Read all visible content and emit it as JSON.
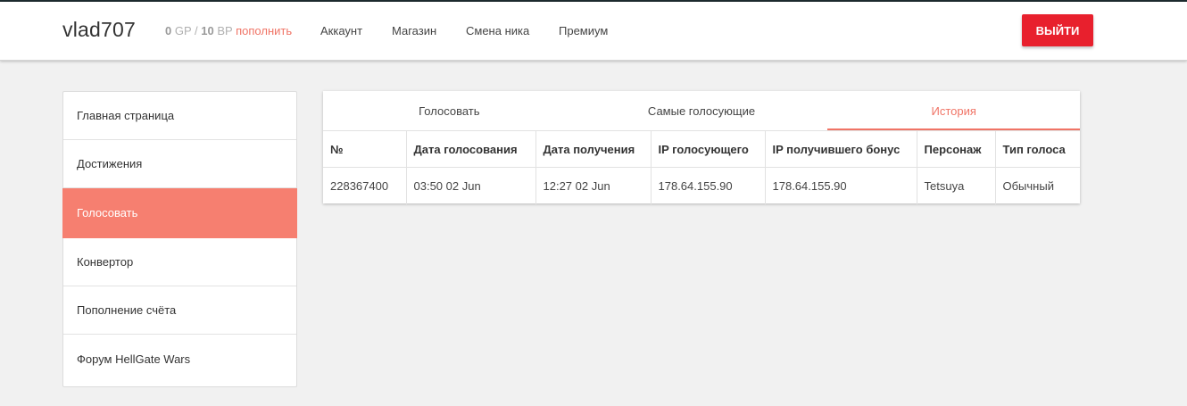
{
  "header": {
    "username": "vlad707",
    "gp_value": "0",
    "gp_unit": "GP",
    "separator": "/",
    "bp_value": "10",
    "bp_unit": "BP",
    "refill_link": "пополнить",
    "nav": [
      "Аккаунт",
      "Магазин",
      "Смена ника",
      "Премиум"
    ],
    "logout_label": "ВЫЙТИ"
  },
  "sidebar": {
    "items": [
      {
        "label": "Главная страница",
        "active": false
      },
      {
        "label": "Достижения",
        "active": false
      },
      {
        "label": "Голосовать",
        "active": true
      },
      {
        "label": "Конвертор",
        "active": false
      },
      {
        "label": "Пополнение счёта",
        "active": false
      },
      {
        "label": "Форум HellGate Wars",
        "active": false
      }
    ]
  },
  "main": {
    "tabs": [
      {
        "label": "Голосовать",
        "active": false
      },
      {
        "label": "Самые голосующие",
        "active": false
      },
      {
        "label": "История",
        "active": true
      }
    ],
    "table": {
      "columns": [
        "№",
        "Дата голосования",
        "Дата получения",
        "IP голосующего",
        "IP получившего бонус",
        "Персонаж",
        "Тип голоса"
      ],
      "rows": [
        [
          "228367400",
          "03:50 02 Jun",
          "12:27 02 Jun",
          "178.64.155.90",
          "178.64.155.90",
          "Tetsuya",
          "Обычный"
        ]
      ]
    }
  },
  "colors": {
    "accent": "#f67f70",
    "logout": "#e8202d",
    "link": "#f07466"
  }
}
